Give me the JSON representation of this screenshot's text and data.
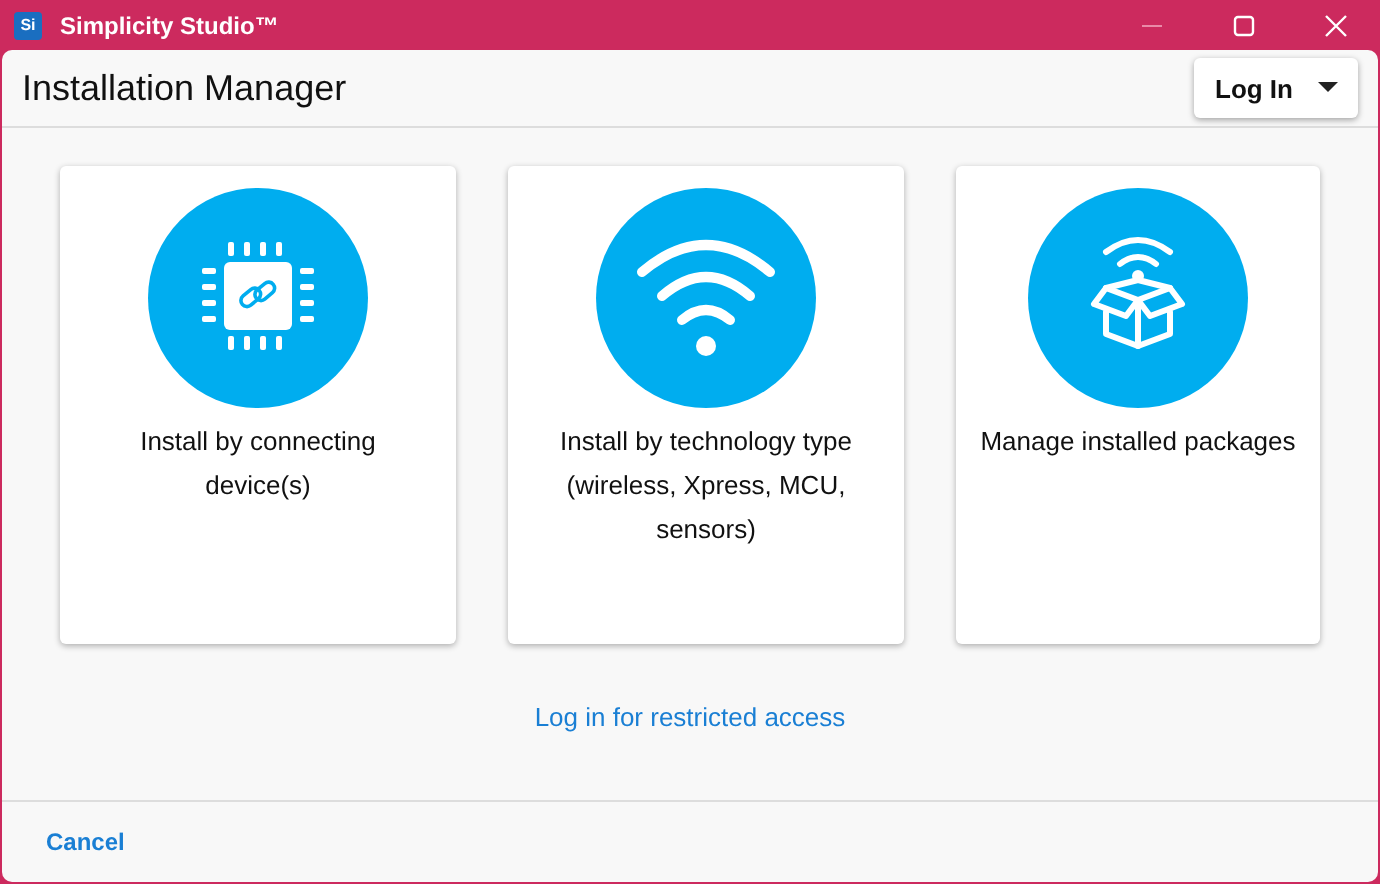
{
  "window": {
    "app_badge": "Si",
    "title": "Simplicity Studio™"
  },
  "header": {
    "title": "Installation Manager",
    "login_button": "Log In"
  },
  "cards": [
    {
      "kind": "chip",
      "label": "Install by connecting device(s)"
    },
    {
      "kind": "wifi",
      "label": "Install by technology type (wireless, Xpress, MCU, sensors)"
    },
    {
      "kind": "package",
      "label": "Manage installed packages"
    }
  ],
  "restricted_link": "Log in for restricted access",
  "footer": {
    "cancel_button": "Cancel"
  }
}
